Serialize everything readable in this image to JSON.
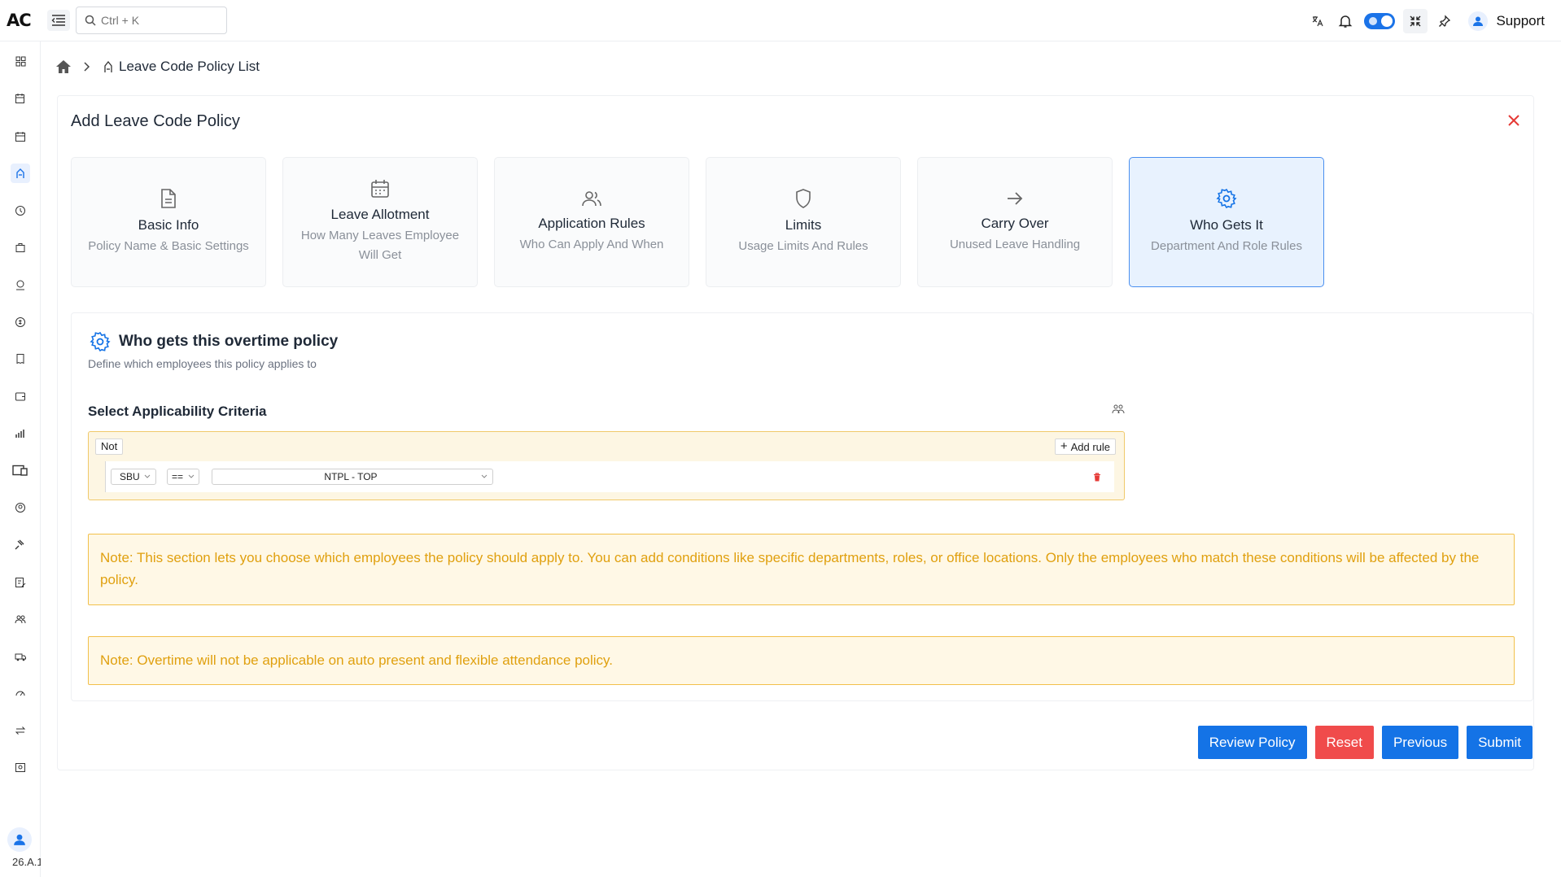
{
  "app": {
    "logo": "AC"
  },
  "topbar": {
    "search_placeholder": "Ctrl + K",
    "support_label": "Support"
  },
  "sidebar": {
    "version": "26.A.1"
  },
  "breadcrumb": {
    "current": "Leave Code Policy List"
  },
  "card": {
    "title": "Add Leave Code Policy"
  },
  "steps": [
    {
      "title": "Basic Info",
      "subtitle": "Policy Name & Basic Settings",
      "icon": "document-icon"
    },
    {
      "title": "Leave Allotment",
      "subtitle": "How Many Leaves Employee Will Get",
      "icon": "calendar-icon"
    },
    {
      "title": "Application Rules",
      "subtitle": "Who Can Apply And When",
      "icon": "users-icon"
    },
    {
      "title": "Limits",
      "subtitle": "Usage Limits And Rules",
      "icon": "shield-icon"
    },
    {
      "title": "Carry Over",
      "subtitle": "Unused Leave Handling",
      "icon": "arrow-right-icon"
    },
    {
      "title": "Who Gets It",
      "subtitle": "Department And Role Rules",
      "icon": "gear-icon",
      "active": true
    }
  ],
  "section": {
    "title": "Who gets this overtime policy",
    "subtitle": "Define which employees this policy applies to",
    "criteria_label": "Select Applicability Criteria"
  },
  "rule_builder": {
    "not_label": "Not",
    "add_rule_label": "Add rule",
    "rule": {
      "field": "SBU",
      "operator": "==",
      "value": "NTPL - TOP"
    }
  },
  "notes": {
    "note1": "Note: This section lets you choose which employees the policy should apply to. You can add conditions like specific departments, roles, or office locations. Only the employees who match these conditions will be affected by the policy.",
    "note2": "Note: Overtime will not be applicable on auto present and flexible attendance policy."
  },
  "actions": {
    "review": "Review Policy",
    "reset": "Reset",
    "previous": "Previous",
    "submit": "Submit"
  },
  "colors": {
    "primary": "#1473e6",
    "danger": "#f04b4b",
    "note_text": "#e0a00f",
    "active_step_bg": "#e8f2fe"
  }
}
